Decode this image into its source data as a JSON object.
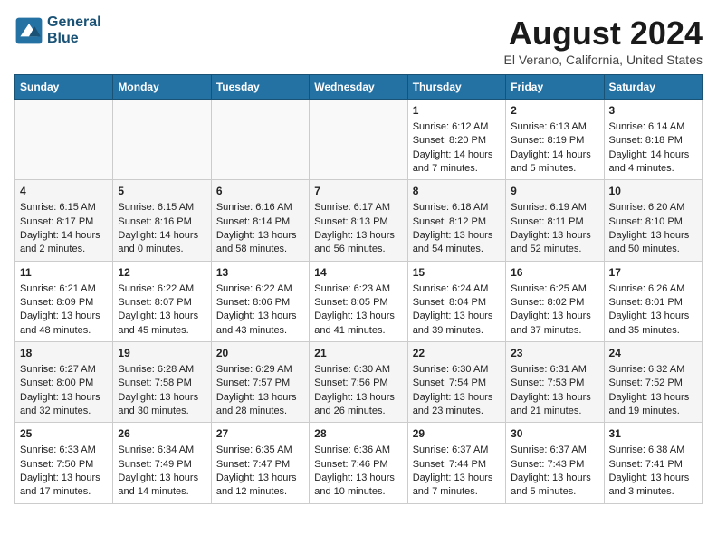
{
  "header": {
    "logo_line1": "General",
    "logo_line2": "Blue",
    "month": "August 2024",
    "location": "El Verano, California, United States"
  },
  "days_of_week": [
    "Sunday",
    "Monday",
    "Tuesday",
    "Wednesday",
    "Thursday",
    "Friday",
    "Saturday"
  ],
  "weeks": [
    [
      {
        "day": "",
        "content": ""
      },
      {
        "day": "",
        "content": ""
      },
      {
        "day": "",
        "content": ""
      },
      {
        "day": "",
        "content": ""
      },
      {
        "day": "1",
        "content": "Sunrise: 6:12 AM\nSunset: 8:20 PM\nDaylight: 14 hours\nand 7 minutes."
      },
      {
        "day": "2",
        "content": "Sunrise: 6:13 AM\nSunset: 8:19 PM\nDaylight: 14 hours\nand 5 minutes."
      },
      {
        "day": "3",
        "content": "Sunrise: 6:14 AM\nSunset: 8:18 PM\nDaylight: 14 hours\nand 4 minutes."
      }
    ],
    [
      {
        "day": "4",
        "content": "Sunrise: 6:15 AM\nSunset: 8:17 PM\nDaylight: 14 hours\nand 2 minutes."
      },
      {
        "day": "5",
        "content": "Sunrise: 6:15 AM\nSunset: 8:16 PM\nDaylight: 14 hours\nand 0 minutes."
      },
      {
        "day": "6",
        "content": "Sunrise: 6:16 AM\nSunset: 8:14 PM\nDaylight: 13 hours\nand 58 minutes."
      },
      {
        "day": "7",
        "content": "Sunrise: 6:17 AM\nSunset: 8:13 PM\nDaylight: 13 hours\nand 56 minutes."
      },
      {
        "day": "8",
        "content": "Sunrise: 6:18 AM\nSunset: 8:12 PM\nDaylight: 13 hours\nand 54 minutes."
      },
      {
        "day": "9",
        "content": "Sunrise: 6:19 AM\nSunset: 8:11 PM\nDaylight: 13 hours\nand 52 minutes."
      },
      {
        "day": "10",
        "content": "Sunrise: 6:20 AM\nSunset: 8:10 PM\nDaylight: 13 hours\nand 50 minutes."
      }
    ],
    [
      {
        "day": "11",
        "content": "Sunrise: 6:21 AM\nSunset: 8:09 PM\nDaylight: 13 hours\nand 48 minutes."
      },
      {
        "day": "12",
        "content": "Sunrise: 6:22 AM\nSunset: 8:07 PM\nDaylight: 13 hours\nand 45 minutes."
      },
      {
        "day": "13",
        "content": "Sunrise: 6:22 AM\nSunset: 8:06 PM\nDaylight: 13 hours\nand 43 minutes."
      },
      {
        "day": "14",
        "content": "Sunrise: 6:23 AM\nSunset: 8:05 PM\nDaylight: 13 hours\nand 41 minutes."
      },
      {
        "day": "15",
        "content": "Sunrise: 6:24 AM\nSunset: 8:04 PM\nDaylight: 13 hours\nand 39 minutes."
      },
      {
        "day": "16",
        "content": "Sunrise: 6:25 AM\nSunset: 8:02 PM\nDaylight: 13 hours\nand 37 minutes."
      },
      {
        "day": "17",
        "content": "Sunrise: 6:26 AM\nSunset: 8:01 PM\nDaylight: 13 hours\nand 35 minutes."
      }
    ],
    [
      {
        "day": "18",
        "content": "Sunrise: 6:27 AM\nSunset: 8:00 PM\nDaylight: 13 hours\nand 32 minutes."
      },
      {
        "day": "19",
        "content": "Sunrise: 6:28 AM\nSunset: 7:58 PM\nDaylight: 13 hours\nand 30 minutes."
      },
      {
        "day": "20",
        "content": "Sunrise: 6:29 AM\nSunset: 7:57 PM\nDaylight: 13 hours\nand 28 minutes."
      },
      {
        "day": "21",
        "content": "Sunrise: 6:30 AM\nSunset: 7:56 PM\nDaylight: 13 hours\nand 26 minutes."
      },
      {
        "day": "22",
        "content": "Sunrise: 6:30 AM\nSunset: 7:54 PM\nDaylight: 13 hours\nand 23 minutes."
      },
      {
        "day": "23",
        "content": "Sunrise: 6:31 AM\nSunset: 7:53 PM\nDaylight: 13 hours\nand 21 minutes."
      },
      {
        "day": "24",
        "content": "Sunrise: 6:32 AM\nSunset: 7:52 PM\nDaylight: 13 hours\nand 19 minutes."
      }
    ],
    [
      {
        "day": "25",
        "content": "Sunrise: 6:33 AM\nSunset: 7:50 PM\nDaylight: 13 hours\nand 17 minutes."
      },
      {
        "day": "26",
        "content": "Sunrise: 6:34 AM\nSunset: 7:49 PM\nDaylight: 13 hours\nand 14 minutes."
      },
      {
        "day": "27",
        "content": "Sunrise: 6:35 AM\nSunset: 7:47 PM\nDaylight: 13 hours\nand 12 minutes."
      },
      {
        "day": "28",
        "content": "Sunrise: 6:36 AM\nSunset: 7:46 PM\nDaylight: 13 hours\nand 10 minutes."
      },
      {
        "day": "29",
        "content": "Sunrise: 6:37 AM\nSunset: 7:44 PM\nDaylight: 13 hours\nand 7 minutes."
      },
      {
        "day": "30",
        "content": "Sunrise: 6:37 AM\nSunset: 7:43 PM\nDaylight: 13 hours\nand 5 minutes."
      },
      {
        "day": "31",
        "content": "Sunrise: 6:38 AM\nSunset: 7:41 PM\nDaylight: 13 hours\nand 3 minutes."
      }
    ]
  ]
}
